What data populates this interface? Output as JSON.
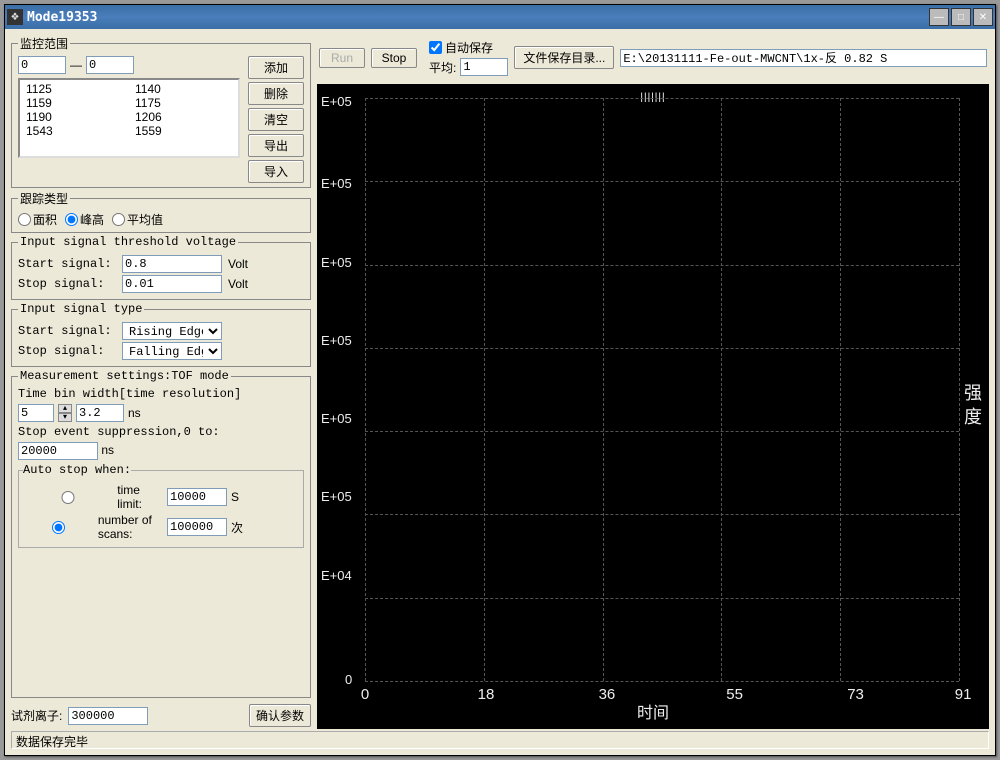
{
  "window": {
    "title": "Mode19353"
  },
  "status": "数据保存完毕",
  "monitor_range": {
    "legend": "监控范围",
    "from": "0",
    "to": "0",
    "btn_add": "添加",
    "btn_del": "删除",
    "btn_clear": "清空",
    "btn_export": "导出",
    "btn_import": "导入",
    "rows": [
      {
        "a": "1125",
        "b": "1140"
      },
      {
        "a": "1159",
        "b": "1175"
      },
      {
        "a": "1190",
        "b": "1206"
      },
      {
        "a": "1543",
        "b": "1559"
      }
    ]
  },
  "track_type": {
    "legend": "跟踪类型",
    "area": "面积",
    "peak": "峰高",
    "avg": "平均值",
    "selected": "peak"
  },
  "threshold": {
    "legend": "Input signal threshold voltage",
    "start_label": "Start signal:",
    "start_value": "0.8",
    "unit": "Volt",
    "stop_label": "Stop  signal:",
    "stop_value": "0.01"
  },
  "sig_type": {
    "legend": "Input signal type",
    "start_label": "Start signal:",
    "start_value": "Rising Edge",
    "stop_label": "Stop  signal:",
    "stop_value": "Falling Edge",
    "options": [
      "Rising Edge",
      "Falling Edge"
    ]
  },
  "measure": {
    "legend": "Measurement settings:TOF mode",
    "timebin_label": "Time bin width[time resolution]",
    "timebin_n": "5",
    "timebin_ns_val": "3.2",
    "ns": "ns",
    "stop_supp_label": "Stop event suppression,0 to:",
    "stop_supp_val": "20000",
    "autostop_legend": "Auto stop when:",
    "time_limit_label": "time limit:",
    "time_limit_val": "10000",
    "time_limit_unit": "S",
    "num_scans_label": "number of scans:",
    "num_scans_val": "100000",
    "num_scans_unit": "次",
    "radio_selected": "scans"
  },
  "reagent_ion": {
    "label": "试剂离子:",
    "value": "300000",
    "confirm": "确认参数"
  },
  "top": {
    "run": "Run",
    "stop": "Stop",
    "autosave_label": "自动保存",
    "avg_label": "平均:",
    "avg_value": "1",
    "save_dir_btn": "文件保存目录...",
    "path": "E:\\20131111-Fe-out-MWCNT\\1x-反 0.82 S"
  },
  "chart_data": {
    "type": "line",
    "title": "",
    "xlabel": "时间",
    "ylabel": "强度",
    "x_ticks": [
      "0",
      "18",
      "36",
      "55",
      "73",
      "91"
    ],
    "y_ticks": [
      "0",
      "E+04",
      "E+05",
      "E+05",
      "E+05",
      "E+05",
      "E+05",
      "E+05"
    ],
    "xlim": [
      0,
      91
    ],
    "series": []
  }
}
